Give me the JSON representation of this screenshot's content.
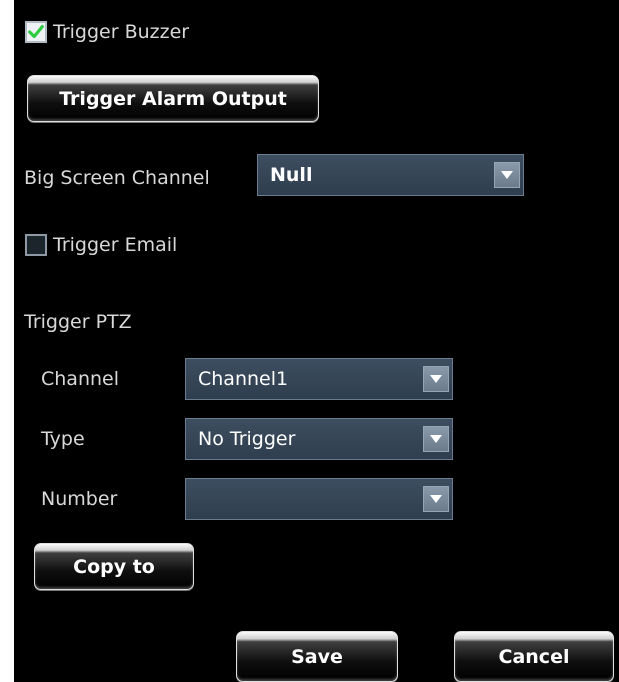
{
  "trigger_buzzer": {
    "label": "Trigger Buzzer",
    "checked": true
  },
  "trigger_alarm_output": {
    "label": "Trigger Alarm Output"
  },
  "big_screen_channel": {
    "label": "Big Screen Channel",
    "value": "Null"
  },
  "trigger_email": {
    "label": "Trigger Email",
    "checked": false
  },
  "trigger_ptz": {
    "label": "Trigger PTZ",
    "channel": {
      "label": "Channel",
      "value": "Channel1"
    },
    "type": {
      "label": "Type",
      "value": "No Trigger"
    },
    "number": {
      "label": "Number",
      "value": ""
    }
  },
  "copy_to": {
    "label": "Copy to"
  },
  "footer": {
    "save_label": "Save",
    "cancel_label": "Cancel"
  },
  "colors": {
    "panel_bg": "#000000",
    "dropdown_bg": "#36475a",
    "check_mark": "#2ecc40",
    "text": "#d8d8d8"
  },
  "icons": {
    "checkmark": "checkmark-icon",
    "dropdown": "chevron-down-icon"
  }
}
